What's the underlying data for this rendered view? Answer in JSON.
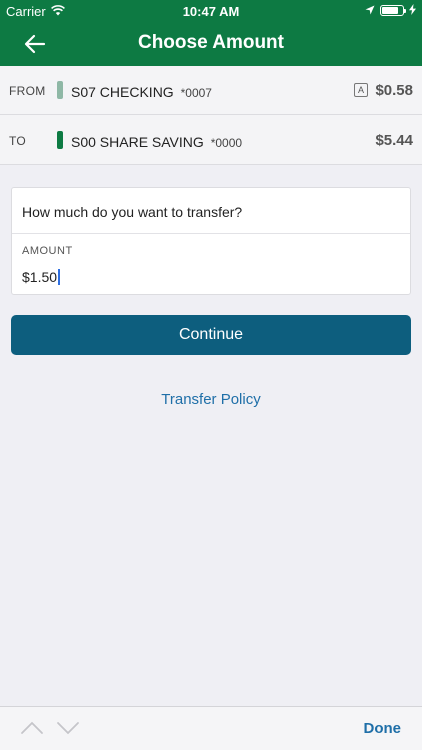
{
  "status_bar": {
    "carrier": "Carrier",
    "time": "10:47 AM"
  },
  "nav": {
    "title": "Choose Amount"
  },
  "accounts": {
    "from": {
      "label": "FROM",
      "name": "S07 CHECKING",
      "number": "*0007",
      "badge": "A",
      "balance": "$0.58",
      "color": "#8fb8a6"
    },
    "to": {
      "label": "TO",
      "name": "S00 SHARE SAVING",
      "number": "*0000",
      "balance": "$5.44",
      "color": "#0d7a43"
    }
  },
  "form": {
    "question": "How much do you want to transfer?",
    "amount_label": "AMOUNT",
    "amount_value": "$1.50"
  },
  "actions": {
    "continue_label": "Continue",
    "policy_label": "Transfer Policy"
  },
  "accessory": {
    "done_label": "Done"
  },
  "colors": {
    "brand": "#0d7a43",
    "button": "#0d5e7e",
    "link": "#1f6fa8"
  }
}
